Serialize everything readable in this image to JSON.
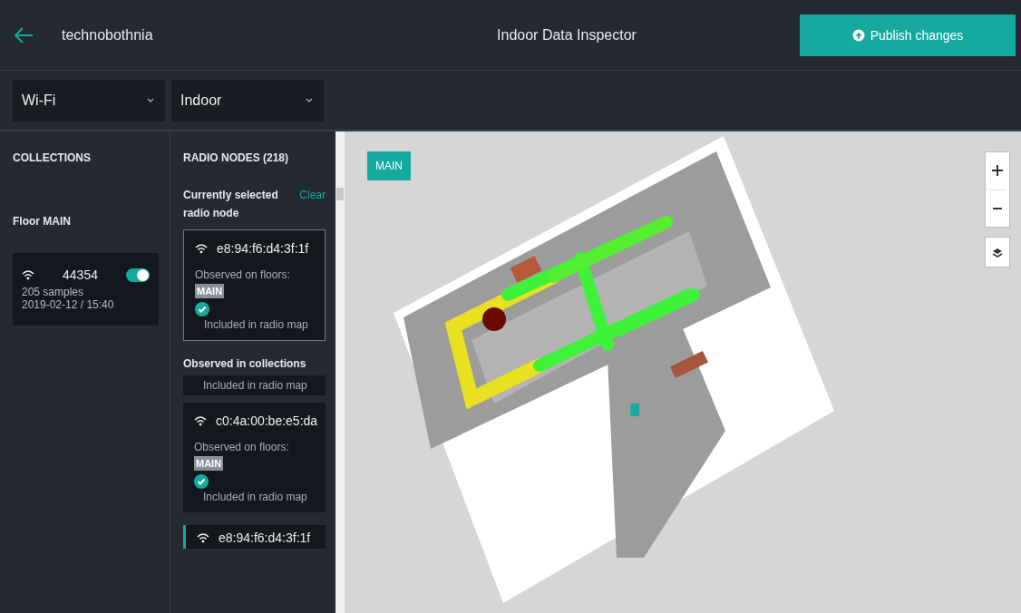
{
  "app_bar": {
    "title": "technobothnia",
    "center_title": "Indoor Data Inspector",
    "publish_button": "Publish changes"
  },
  "filters": [
    {
      "value": "Wi-Fi"
    },
    {
      "value": "Indoor"
    }
  ],
  "collections": {
    "heading": "COLLECTIONS",
    "floor": "Floor MAIN",
    "items": [
      {
        "name": "44354",
        "on": true,
        "samples": "205 samples",
        "timestamp": "2019-02-12 / 15:40"
      }
    ]
  },
  "radio_nodes": {
    "heading": "RADIO NODES (218)",
    "selected_label": "Currently selected radio node",
    "clear_link": "Clear",
    "selected_node": {
      "mac": "e8:94:f6:d4:3f:1f",
      "observed_label": "Observed on floors:",
      "floors": [
        "MAIN"
      ],
      "included": true,
      "included_label": "Included in radio map"
    },
    "collections_heading": "Observed in collections",
    "nodes": [
      {
        "kind": "tail",
        "selected": false,
        "included_label": "Included in radio map"
      },
      {
        "kind": "card",
        "selected": false,
        "mac": "c0:4a:00:be:e5:da",
        "observed_label": "Observed on floors:",
        "floors": [
          "MAIN"
        ],
        "included": true,
        "included_label": "Included in radio map"
      },
      {
        "kind": "head",
        "selected": true,
        "mac": "e8:94:f6:d4:3f:1f"
      }
    ]
  },
  "map": {
    "floor_badge": "MAIN"
  }
}
